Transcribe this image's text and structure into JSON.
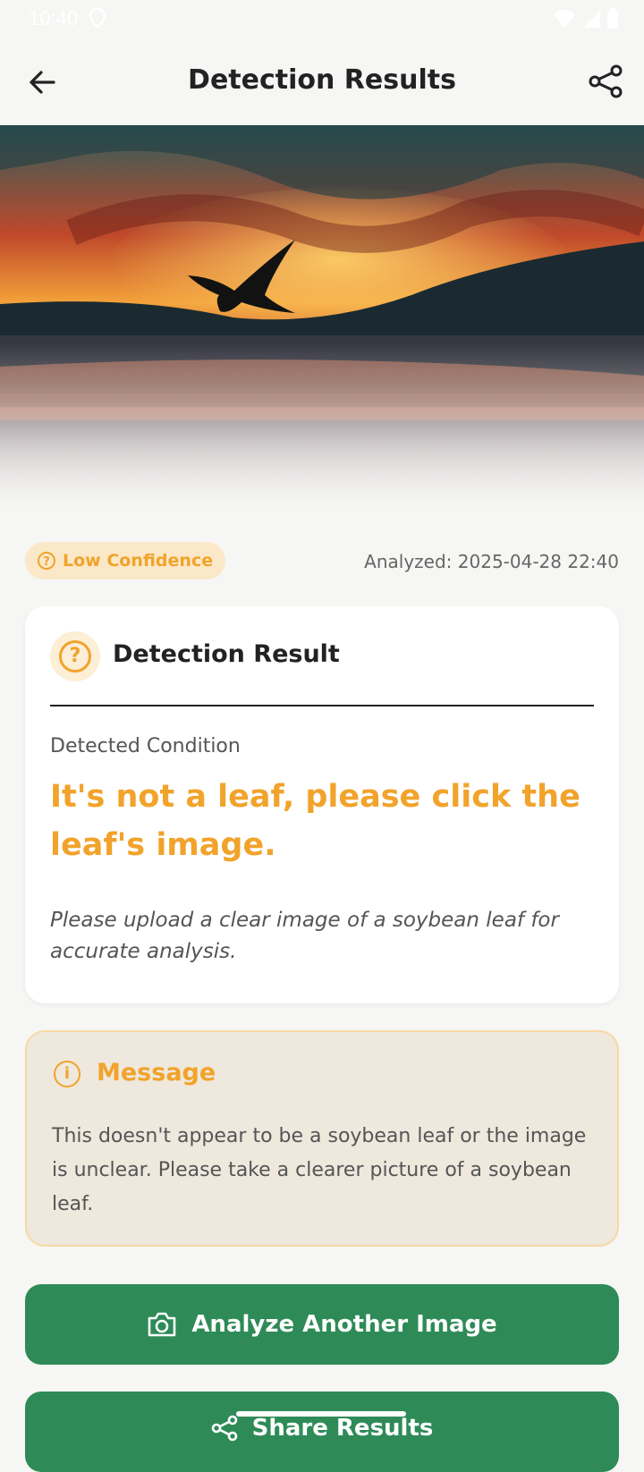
{
  "status_bar": {
    "time": "10:40"
  },
  "header": {
    "title": "Detection Results",
    "back_icon": "arrow-left-icon",
    "share_icon": "share-icon"
  },
  "confidence": {
    "label": "Low Confidence",
    "color": "#f1a32b"
  },
  "analyzed": "Analyzed: 2025-04-28 22:40",
  "result_card": {
    "title": "Detection Result",
    "condition_label": "Detected Condition",
    "condition_value": "It's not a leaf, please click the leaf's image.",
    "hint": "Please upload a clear image of a soybean leaf for accurate analysis."
  },
  "message": {
    "title": "Message",
    "body": "This doesn't appear to be a soybean leaf or the image is unclear. Please take a clearer picture of a soybean leaf."
  },
  "buttons": {
    "analyze_label": "Analyze Another Image",
    "share_label": "Share Results"
  },
  "colors": {
    "accent": "#f1a32b",
    "primary": "#2e8b57",
    "background": "#f6f6f4"
  }
}
